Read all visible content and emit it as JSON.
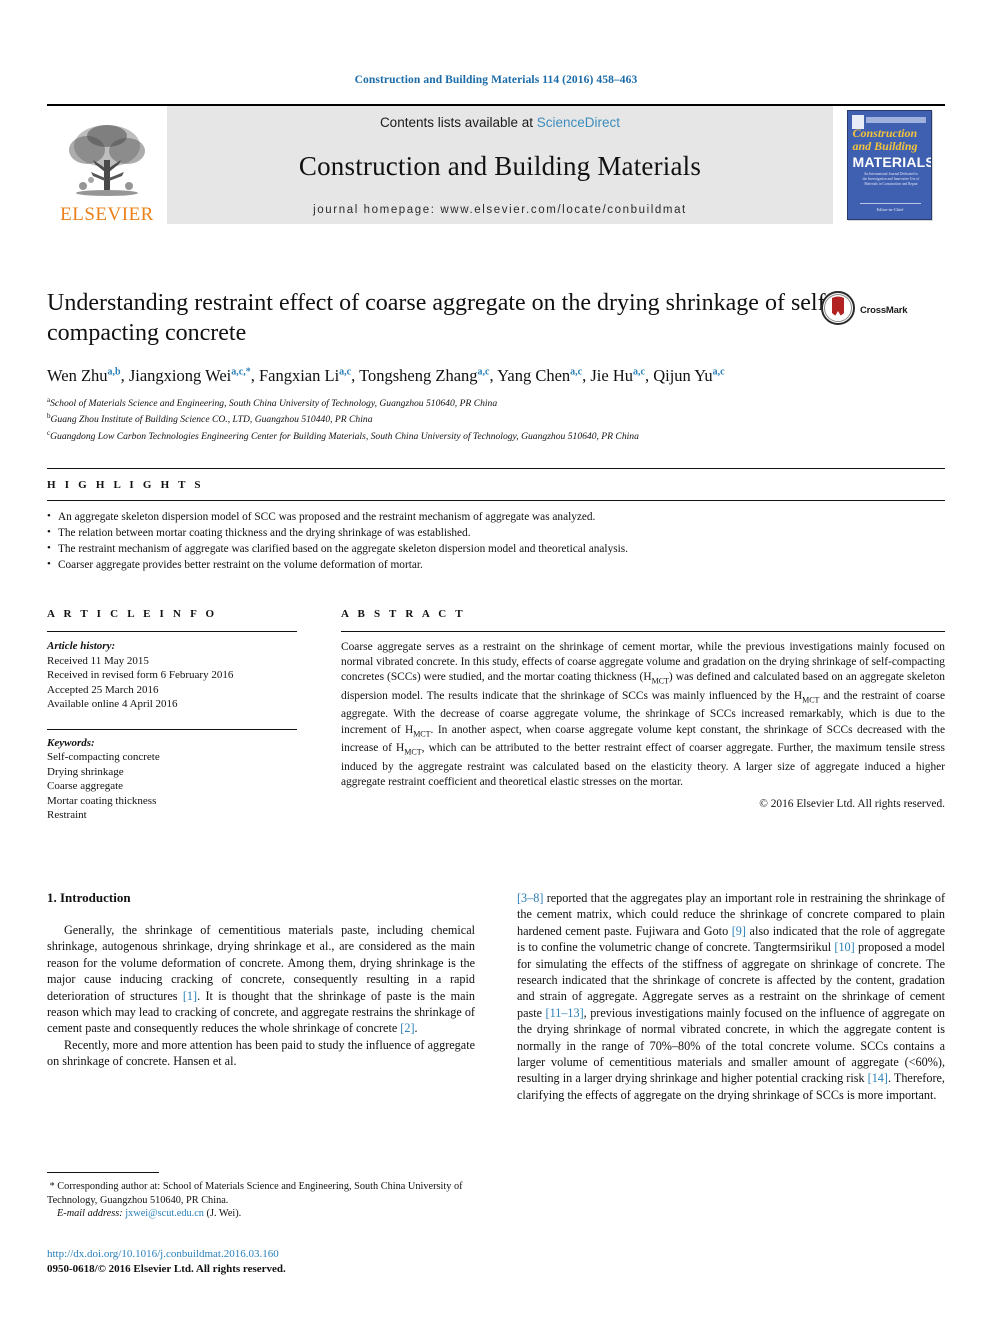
{
  "running_head": "Construction and Building Materials 114 (2016) 458–463",
  "masthead": {
    "publisher_name": "ELSEVIER",
    "publisher_logo_icon": "elsevier-tree-logo",
    "contents_prefix": "Contents lists available at ",
    "contents_link": "ScienceDirect",
    "journal_title": "Construction and Building Materials",
    "homepage_line": "journal homepage: www.elsevier.com/locate/conbuildmat",
    "cover": {
      "line1": "Construction",
      "line2": "and Building",
      "line3": "MATERIALS",
      "subtitle": "An International Journal Dedicated to the Investigation and Innovative Use of Materials in Construction and Repair",
      "footer": "Editor-in-Chief"
    }
  },
  "article": {
    "title": "Understanding restraint effect of coarse aggregate on the drying shrinkage of self-compacting concrete",
    "crossmark_label": "CrossMark",
    "crossmark_icon": "crossmark-badge-icon",
    "authors": [
      {
        "name": "Wen Zhu",
        "sup": "a,b",
        "sep": ", "
      },
      {
        "name": "Jiangxiong Wei",
        "sup": "a,c,*",
        "sep": ", "
      },
      {
        "name": "Fangxian Li",
        "sup": "a,c",
        "sep": ", "
      },
      {
        "name": "Tongsheng Zhang",
        "sup": "a,c",
        "sep": ", "
      },
      {
        "name": "Yang Chen",
        "sup": "a,c",
        "sep": ", "
      },
      {
        "name": "Jie Hu",
        "sup": "a,c",
        "sep": ", "
      },
      {
        "name": "Qijun Yu",
        "sup": "a,c",
        "sep": ""
      }
    ],
    "affiliations": [
      {
        "mark": "a",
        "text": "School of Materials Science and Engineering, South China University of Technology, Guangzhou 510640, PR China"
      },
      {
        "mark": "b",
        "text": "Guang Zhou Institute of Building Science CO., LTD, Guangzhou 510440, PR China"
      },
      {
        "mark": "c",
        "text": "Guangdong Low Carbon Technologies Engineering Center for Building Materials, South China University of Technology, Guangzhou 510640, PR China"
      }
    ]
  },
  "highlights": {
    "heading": "H I G H L I G H T S",
    "items": [
      "An aggregate skeleton dispersion model of SCC was proposed and the restraint mechanism of aggregate was analyzed.",
      "The relation between mortar coating thickness and the drying shrinkage of was established.",
      "The restraint mechanism of aggregate was clarified based on the aggregate skeleton dispersion model and theoretical analysis.",
      "Coarser aggregate provides better restraint on the volume deformation of mortar."
    ]
  },
  "article_info": {
    "heading": "A R T I C L E  I N F O",
    "history_label": "Article history:",
    "history": [
      "Received 11 May 2015",
      "Received in revised form 6 February 2016",
      "Accepted 25 March 2016",
      "Available online 4 April 2016"
    ],
    "keywords_label": "Keywords:",
    "keywords": [
      "Self-compacting concrete",
      "Drying shrinkage",
      "Coarse aggregate",
      "Mortar coating thickness",
      "Restraint"
    ]
  },
  "abstract": {
    "heading": "A B S T R A C T",
    "p1_a": "Coarse aggregate serves as a restraint on the shrinkage of cement mortar, while the previous investigations mainly focused on normal vibrated concrete. In this study, effects of coarse aggregate volume and gradation on the drying shrinkage of self-compacting concretes (SCCs) were studied, and the mortar coating thickness (H",
    "p1_sub1": "MCT",
    "p1_b": ") was defined and calculated based on an aggregate skeleton dispersion model. The results indicate that the shrinkage of SCCs was mainly influenced by the H",
    "p1_sub2": "MCT",
    "p1_c": " and the restraint of coarse aggregate. With the decrease of coarse aggregate volume, the shrinkage of SCCs increased remarkably, which is due to the increment of H",
    "p1_sub3": "MCT",
    "p1_d": ". In another aspect, when coarse aggregate volume kept constant, the shrinkage of SCCs decreased with the increase of H",
    "p1_sub4": "MCT",
    "p1_e": ", which can be attributed to the better restraint effect of coarser aggregate. Further, the maximum tensile stress induced by the aggregate restraint was calculated based on the elasticity theory. A larger size of aggregate induced a higher aggregate restraint coefficient and theoretical elastic stresses on the mortar.",
    "copyright": "© 2016 Elsevier Ltd. All rights reserved."
  },
  "introduction": {
    "section_number_title": "1. Introduction",
    "left_p1_a": "Generally, the shrinkage of cementitious materials paste, including chemical shrinkage, autogenous shrinkage, drying shrinkage et al., are considered as the main reason for the volume deformation of concrete. Among them, drying shrinkage is the major cause inducing cracking of concrete, consequently resulting in a rapid deterioration of structures ",
    "left_p1_ref1": "[1]",
    "left_p1_b": ". It is thought that the shrinkage of paste is the main reason which may lead to cracking of concrete, and aggregate restrains the shrinkage of cement paste and consequently reduces the whole shrinkage of concrete ",
    "left_p1_ref2": "[2]",
    "left_p1_c": ".",
    "left_p2": "Recently, more and more attention has been paid to study the influence of aggregate on shrinkage of concrete. Hansen et al.",
    "right_ref1": "[3–8]",
    "right_a": " reported that the aggregates play an important role in restraining the shrinkage of the cement matrix, which could reduce the shrinkage of concrete compared to plain hardened cement paste. Fujiwara and Goto ",
    "right_ref2": "[9]",
    "right_b": " also indicated that the role of aggregate is to confine the volumetric change of concrete. Tangtermsirikul ",
    "right_ref3": "[10]",
    "right_c": " proposed a model for simulating the effects of the stiffness of aggregate on shrinkage of concrete. The research indicated that the shrinkage of concrete is affected by the content, gradation and strain of aggregate. Aggregate serves as a restraint on the shrinkage of cement paste ",
    "right_ref4": "[11–13]",
    "right_d": ", previous investigations mainly focused on the influence of aggregate on the drying shrinkage of normal vibrated concrete, in which the aggregate content is normally in the range of 70%–80% of the total concrete volume. SCCs contains a larger volume of cementitious materials and smaller amount of aggregate (<60%), resulting in a larger drying shrinkage and higher potential cracking risk ",
    "right_ref5": "[14]",
    "right_e": ". Therefore, clarifying the effects of aggregate on the drying shrinkage of SCCs is more important."
  },
  "footnote": {
    "star": "*",
    "corresponding_text": " Corresponding author at: School of Materials Science and Engineering, South China University of Technology, Guangzhou 510640, PR China.",
    "email_label": "E-mail address:",
    "email": "jxwei@scut.edu.cn",
    "email_suffix": " (J. Wei)."
  },
  "page_footer": {
    "doi": "http://dx.doi.org/10.1016/j.conbuildmat.2016.03.160",
    "issn_line": "0950-0618/© 2016 Elsevier Ltd. All rights reserved."
  },
  "colors": {
    "link_blue": "#2a7fb8",
    "sciencedirect_blue": "#3c8dbc",
    "elsevier_orange": "#ec8019",
    "band_grey": "#e6e6e6",
    "cover_blue": "#3f5fb0",
    "cover_yellow": "#f3c43c",
    "crossmark_red": "#b22222"
  }
}
